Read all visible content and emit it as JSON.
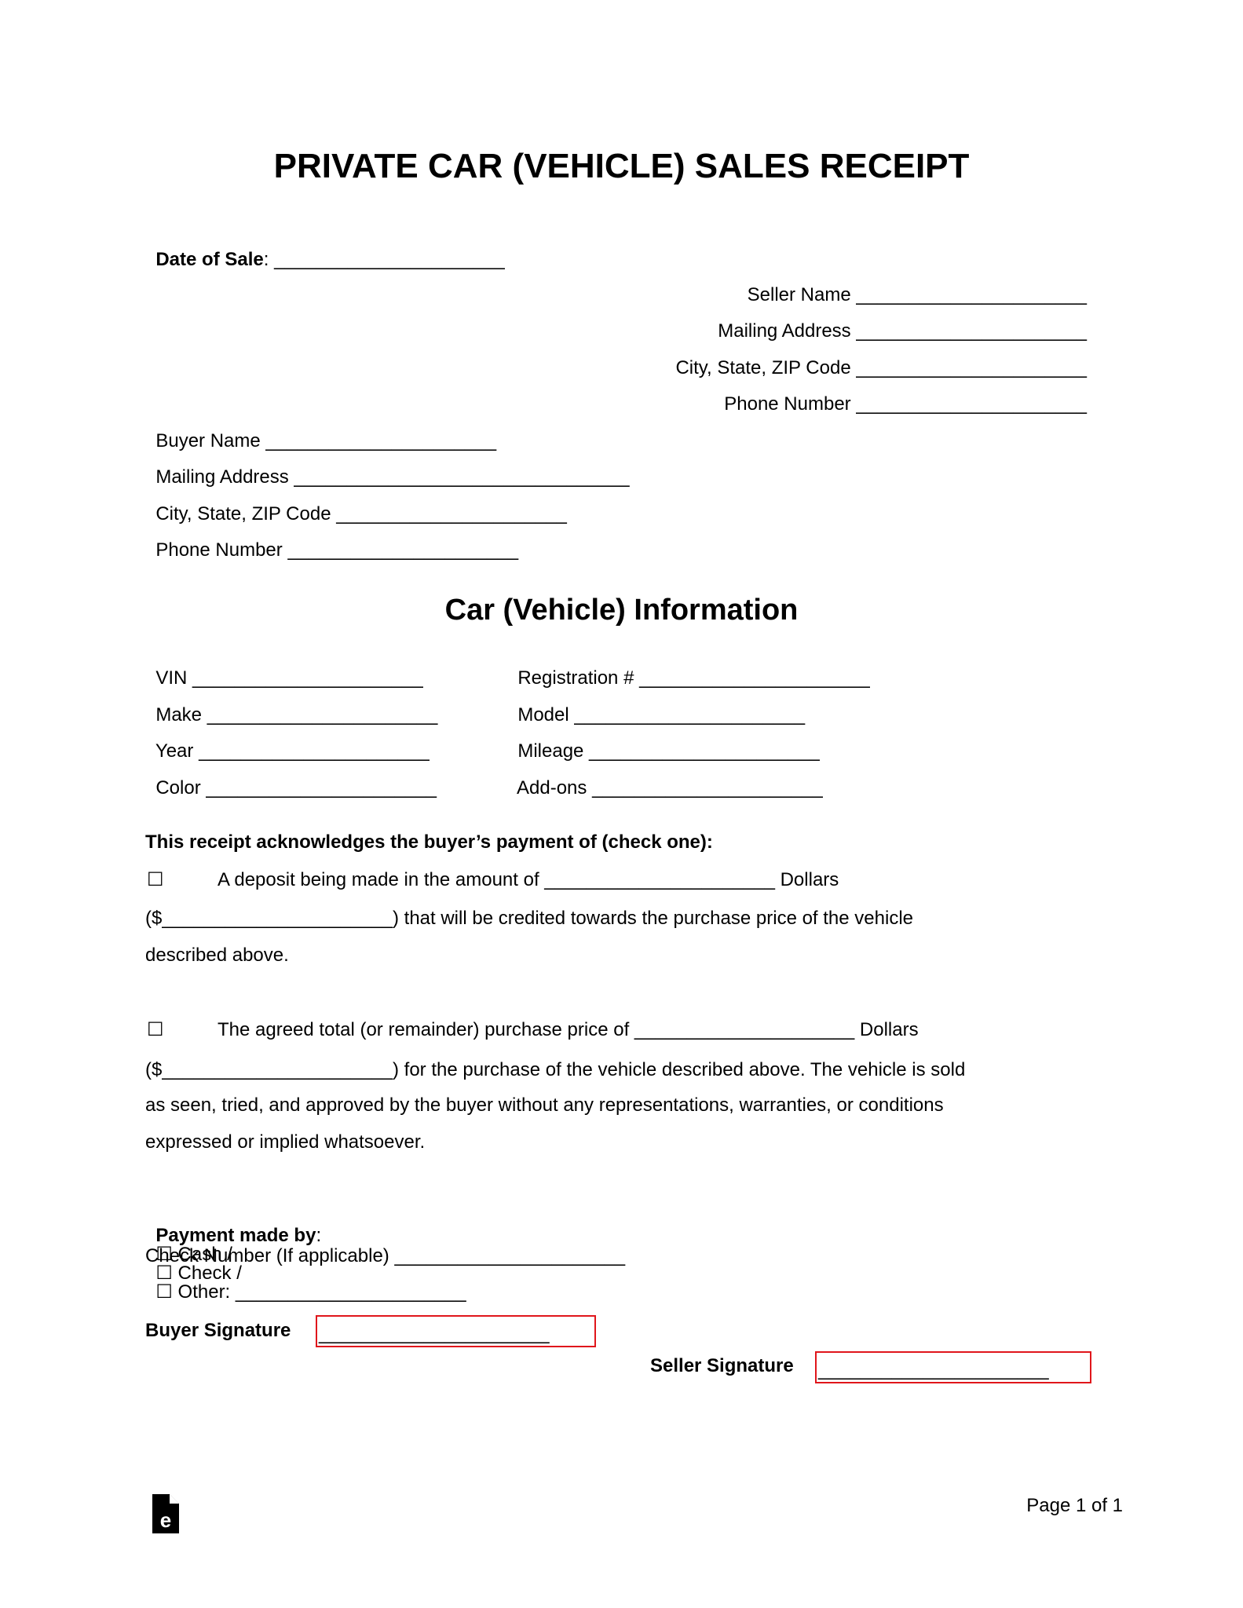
{
  "title": "PRIVATE CAR (VEHICLE) SALES RECEIPT",
  "date_of_sale": {
    "label": "Date of Sale",
    "colon": ":",
    "blank": " ______________________"
  },
  "seller": {
    "fields": [
      {
        "label": "Seller Name",
        "blank": " ______________________"
      },
      {
        "label": "Mailing Address",
        "blank": " ______________________"
      },
      {
        "label": "City, State, ZIP Code",
        "blank": " ______________________"
      },
      {
        "label": "Phone Number",
        "blank": " ______________________"
      }
    ]
  },
  "buyer": {
    "fields": [
      {
        "label": "Buyer Name",
        "blank": " ______________________"
      },
      {
        "label": "Mailing Address",
        "blank": " ________________________________"
      },
      {
        "label": "City, State, ZIP Code",
        "blank": " ______________________"
      },
      {
        "label": "Phone Number",
        "blank": " ______________________"
      }
    ]
  },
  "vehicle": {
    "heading": "Car (Vehicle) Information",
    "left": [
      {
        "label": "VIN",
        "blank": " ______________________"
      },
      {
        "label": "Make",
        "blank": " ______________________"
      },
      {
        "label": "Year",
        "blank": " ______________________"
      },
      {
        "label": "Color",
        "blank": " ______________________"
      }
    ],
    "right": [
      {
        "label": "Registration #",
        "blank": " ______________________"
      },
      {
        "label": "Model",
        "blank": " ______________________"
      },
      {
        "label": "Mileage",
        "blank": " ______________________"
      },
      {
        "label": "Add-ons",
        "blank": " ______________________"
      }
    ]
  },
  "payment": {
    "heading": "This receipt acknowledges the buyer’s payment of (check one):",
    "checkbox_glyph": "☐",
    "option_deposit": {
      "line1": "A deposit being made in the amount of ______________________ Dollars",
      "line2": "($______________________) that will be credited towards the purchase price of the vehicle",
      "line3": "described above."
    },
    "option_total": {
      "line1": "The agreed total (or remainder) purchase price of _____________________ Dollars",
      "line2": "($______________________) for the purchase of the vehicle described above. The vehicle is sold",
      "line3": "as seen, tried, and approved by the buyer without any representations, warranties, or conditions",
      "line4": "expressed or implied whatsoever."
    }
  },
  "method": {
    "label": "Payment made by",
    "colon": ":",
    "cash": "Cash /",
    "check": "Check /",
    "other": "Other: ______________________",
    "check_number": "Check Number (If applicable) ______________________"
  },
  "signatures": {
    "buyer_label": "Buyer Signature",
    "buyer_blank": "______________________",
    "seller_label": "Seller Signature",
    "seller_blank": "______________________",
    "highlight_color": "#e0161b"
  },
  "footer": {
    "logo_icon": "eforms-logo-icon",
    "page_label": "Page 1 of 1"
  }
}
